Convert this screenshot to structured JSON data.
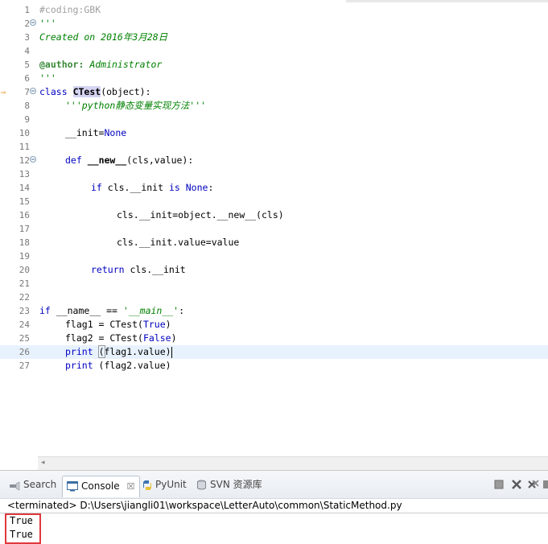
{
  "editor": {
    "lines": [
      {
        "n": "1"
      },
      {
        "n": "2"
      },
      {
        "n": "3"
      },
      {
        "n": "4"
      },
      {
        "n": "5"
      },
      {
        "n": "6"
      },
      {
        "n": "7"
      },
      {
        "n": "8"
      },
      {
        "n": "9"
      },
      {
        "n": "10"
      },
      {
        "n": "11"
      },
      {
        "n": "12"
      },
      {
        "n": "13"
      },
      {
        "n": "14"
      },
      {
        "n": "15"
      },
      {
        "n": "16"
      },
      {
        "n": "17"
      },
      {
        "n": "18"
      },
      {
        "n": "19"
      },
      {
        "n": "20"
      },
      {
        "n": "21"
      },
      {
        "n": "22"
      },
      {
        "n": "23"
      },
      {
        "n": "24"
      },
      {
        "n": "25"
      },
      {
        "n": "26"
      },
      {
        "n": "27"
      }
    ],
    "t": {
      "l1": "#coding:GBK",
      "l2": "'''",
      "l3": "Created on 2016年3月28日",
      "l5a": "@author:",
      "l5b": " Administrator",
      "l6": "'''",
      "l7kw": "class",
      "l7name": "CTest",
      "l7rest": "(object):",
      "l8": "'''python静态变量实现方法'''",
      "l10a": "__init=",
      "l10b": "None",
      "l12kw": "def",
      "l12name": "__new__",
      "l12rest": "(cls,value):",
      "l14kw": "if",
      "l14a": " cls.__init ",
      "l14is": "is",
      "l14none": "None",
      "l14colon": ":",
      "l16": "cls.__init=object.__new__(cls)",
      "l18": "cls.__init.value=value",
      "l20kw": "return",
      "l20rest": " cls.__init",
      "l23kw": "if",
      "l23a": " __name__ == ",
      "l23str": "'__main__'",
      "l23colon": ":",
      "l24a": "flag1 = CTest(",
      "l24b": "True",
      "l24c": ")",
      "l25a": "flag2 = CTest(",
      "l25b": "False",
      "l25c": ")",
      "l26kw": "print",
      "l26sp": " ",
      "l26open": "(",
      "l26rest": "flag1.value)",
      "l27kw": "print",
      "l27rest": " (flag2.value)"
    }
  },
  "panel": {
    "tabs": {
      "search": "Search",
      "console": "Console",
      "console_close": "☒",
      "pyunit": "PyUnit",
      "svn": "SVN 资源库"
    },
    "console_path": "<terminated> D:\\Users\\jiangli01\\workspace\\LetterAuto\\common\\StaticMethod.py",
    "output": [
      "True",
      "True"
    ]
  },
  "colors": {
    "keyword": "#0000c0",
    "string": "#008000",
    "comment": "#a0a0a0",
    "highlight_box": "#e0393e"
  }
}
